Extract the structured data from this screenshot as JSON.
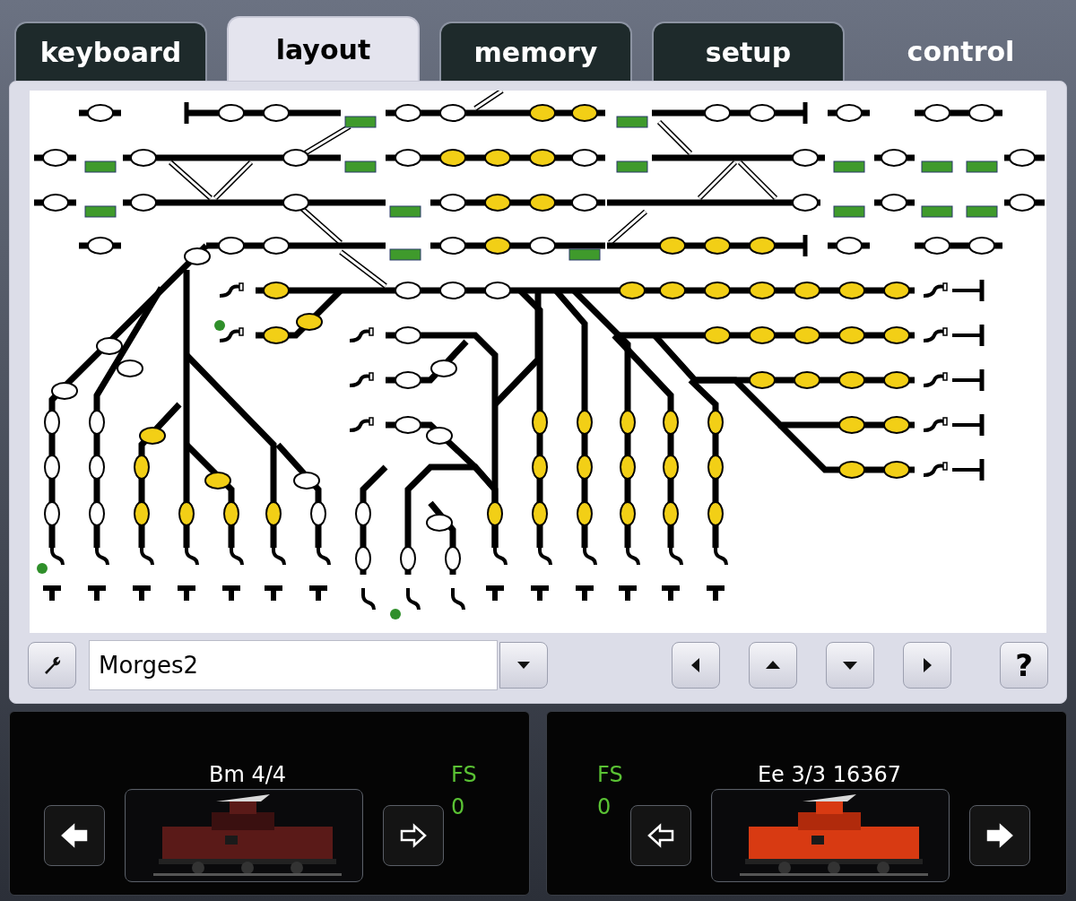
{
  "tabs": [
    {
      "label": "keyboard",
      "kind": "tab",
      "selected": false
    },
    {
      "label": "layout",
      "kind": "tab",
      "selected": true
    },
    {
      "label": "memory",
      "kind": "tab",
      "selected": false
    },
    {
      "label": "setup",
      "kind": "tab",
      "selected": false
    },
    {
      "label": "control",
      "kind": "plain",
      "selected": false
    }
  ],
  "layout_toolbar": {
    "layout_name": "Morges2",
    "help_button": "?"
  },
  "locomotives": [
    {
      "name": "Bm 4/4",
      "speed_label": "FS",
      "speed": "0",
      "reverse": true
    },
    {
      "name": "Ee 3/3 16367",
      "speed_label": "FS",
      "speed": "0",
      "reverse": false
    }
  ]
}
